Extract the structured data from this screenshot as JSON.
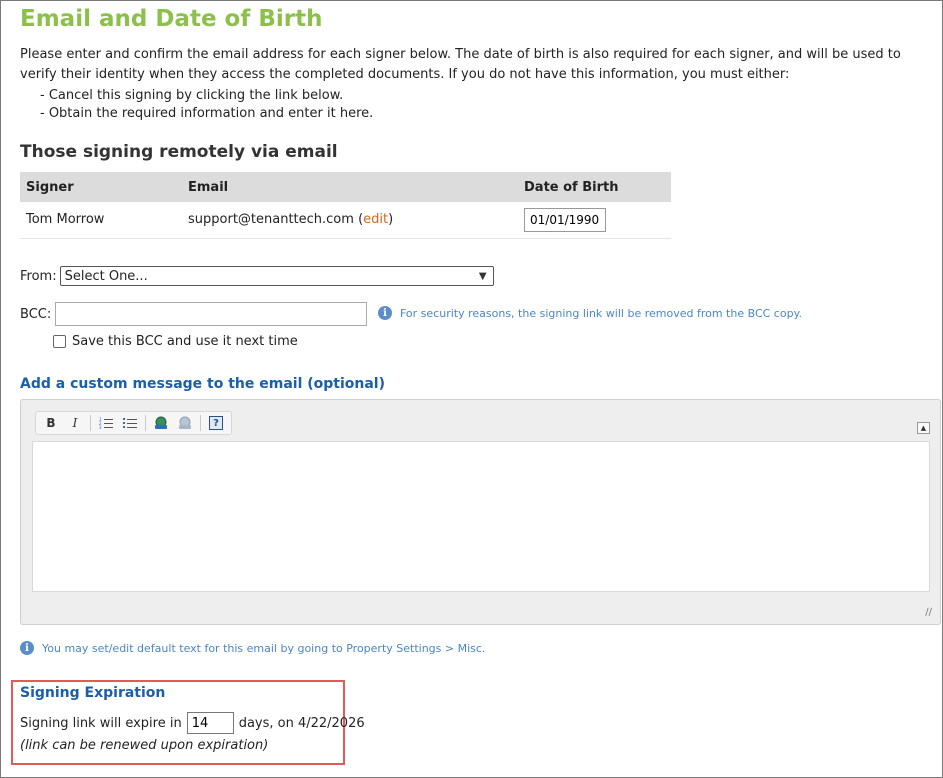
{
  "page": {
    "title": "Email and Date of Birth",
    "intro": "Please enter and confirm the email address for each signer below. The date of birth is also required for each signer, and will be used to verify their identity when they access the completed documents. If you do not have this information, you must either:",
    "bullets": [
      "- Cancel this signing by clicking the link below.",
      "- Obtain the required information and enter it here."
    ]
  },
  "remote": {
    "heading": "Those signing remotely via email",
    "columns": [
      "Signer",
      "Email",
      "Date of Birth"
    ],
    "rows": [
      {
        "signer": "Tom Morrow",
        "email": "support@tenanttech.com",
        "edit_open": " (",
        "edit_label": "edit",
        "edit_close": ")",
        "dob": "01/01/1990"
      }
    ]
  },
  "from": {
    "label": "From:",
    "selected": "Select One..."
  },
  "bcc": {
    "label": "BCC:",
    "value": "",
    "note": "For security reasons, the signing link will be removed from the BCC copy.",
    "save_label": "Save this BCC and use it next time"
  },
  "custom_message": {
    "heading": "Add a custom message to the email (optional)",
    "toolbar": [
      "B",
      "I",
      "numbered-list",
      "bulleted-list",
      "link",
      "unlink",
      "?"
    ],
    "body": ""
  },
  "default_note": "You may set/edit default text for this email by going to Property Settings > Misc.",
  "expiration": {
    "heading": "Signing Expiration",
    "prefix": "Signing link will expire in",
    "days": "14",
    "suffix": "days, on 4/22/2026",
    "note": "(link can be renewed upon expiration)"
  },
  "colors": {
    "title": "#8cc04b",
    "heading_blue": "#1a5fa8",
    "highlight_border": "#e05a5a",
    "note_blue": "#4a86c5",
    "edit_link": "#d2691e"
  }
}
